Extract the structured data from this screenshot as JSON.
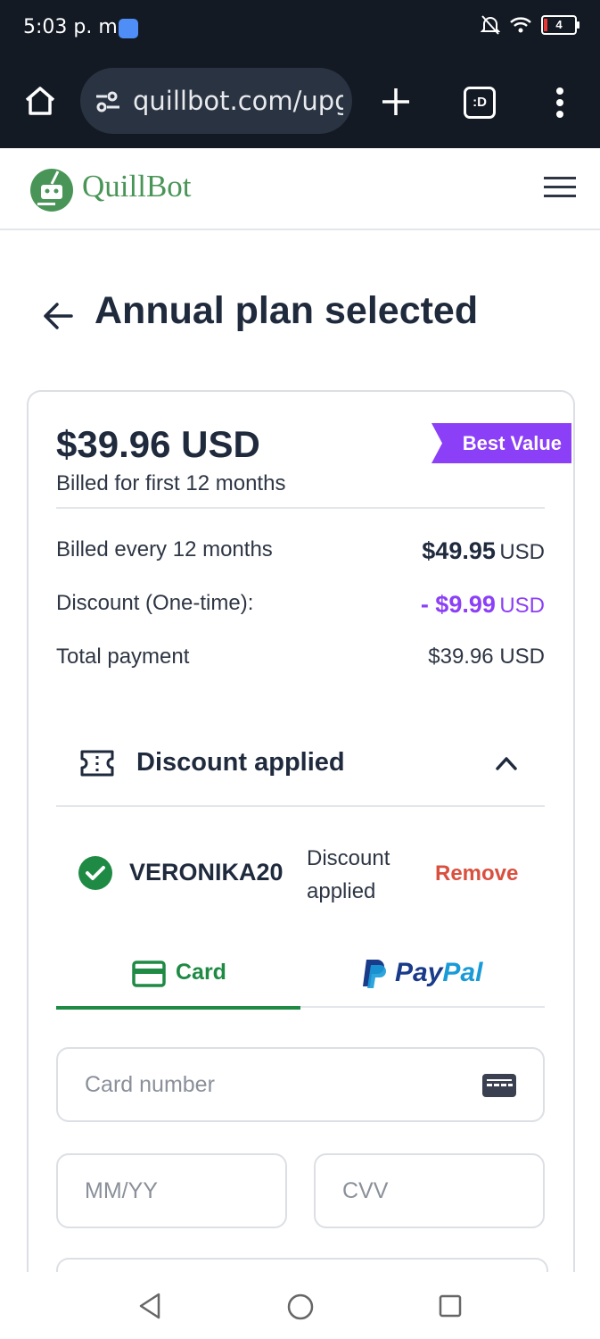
{
  "status_bar": {
    "time": "5:03 p. m.",
    "battery": "4"
  },
  "browser": {
    "url": "quillbot.com/upgrade",
    "tab_switcher_label": ":D"
  },
  "header": {
    "logo_text": "QuillBot"
  },
  "page": {
    "title": "Annual plan selected"
  },
  "plan": {
    "price": "$39.96 USD",
    "subtitle": "Billed for first 12 months",
    "badge": "Best Value",
    "rows": [
      {
        "label": "Billed every 12 months",
        "amount": "$49.95",
        "currency": "USD"
      },
      {
        "label": "Discount (One-time):",
        "amount": "- $9.99",
        "currency": "USD"
      },
      {
        "label": "Total payment",
        "value": "$39.96 USD"
      }
    ]
  },
  "discount": {
    "title": "Discount applied",
    "code": "VERONIKA20",
    "status": "Discount applied",
    "remove_label": "Remove"
  },
  "payment": {
    "tabs": [
      {
        "label": "Card"
      },
      {
        "label_part1": "Pay",
        "label_part2": "Pal"
      }
    ],
    "card_number_placeholder": "Card number",
    "expiry_placeholder": "MM/YY",
    "cvv_placeholder": "CVV"
  },
  "colors": {
    "brand_green": "#499557",
    "accent_green": "#1e8a44",
    "purple": "#8b3ff7",
    "remove_red": "#d9503f"
  }
}
